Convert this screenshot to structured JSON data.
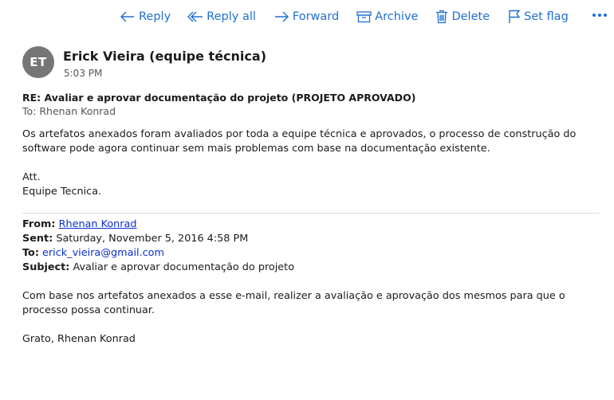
{
  "toolbar": {
    "reply": "Reply",
    "reply_all": "Reply all",
    "forward": "Forward",
    "archive": "Archive",
    "delete": "Delete",
    "set_flag": "Set flag",
    "accent_color": "#1f6fd0"
  },
  "message": {
    "avatar_initials": "ET",
    "sender_name": "Erick Vieira (equipe técnica)",
    "time": "5:03 PM",
    "subject": "RE: Avaliar e aprovar documentação do projeto (PROJETO APROVADO)",
    "to_label": "To:",
    "to_value": "Rhenan Konrad",
    "body_paragraph": "Os artefatos anexados foram avaliados por toda a equipe técnica e aprovados, o processo de construção do software pode agora continuar sem mais problemas com base na documentação existente.",
    "signoff_line1": "Att.",
    "signoff_line2": "Equipe Tecnica."
  },
  "quoted": {
    "from_label": "From:",
    "from_value": "Rhenan Konrad",
    "sent_label": "Sent:",
    "sent_value": "Saturday, November 5, 2016 4:58 PM",
    "to_label": "To:",
    "to_value": "erick_vieira@gmail.com",
    "subject_label": "Subject:",
    "subject_value": "Avaliar e aprovar documentação do projeto",
    "body": "Com base nos artefatos anexados a esse e-mail, realizer a avaliação e aprovação dos mesmos para que o processo possa continuar.",
    "signature": "Grato, Rhenan Konrad"
  }
}
